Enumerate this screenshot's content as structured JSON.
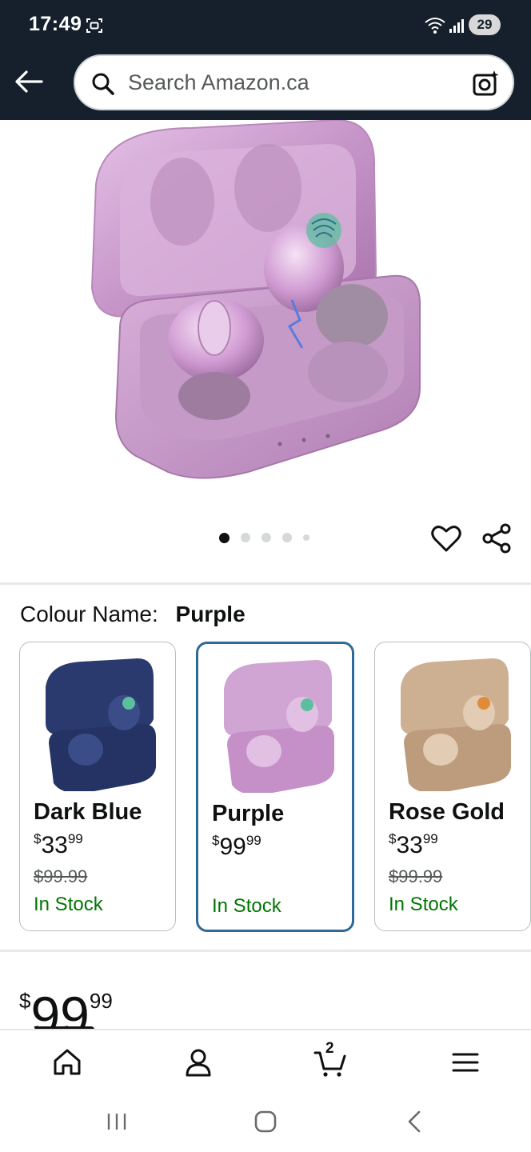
{
  "status_bar": {
    "time": "17:49",
    "battery": "29"
  },
  "search": {
    "placeholder": "Search Amazon.ca"
  },
  "gallery": {
    "image_count": 5,
    "active_index": 0
  },
  "colour": {
    "label": "Colour Name:",
    "selected": "Purple"
  },
  "swatches": [
    {
      "name": "Dark Blue",
      "currency": "$",
      "whole": "33",
      "cents": "99",
      "list_price": "$99.99",
      "stock": "In Stock",
      "color": "#2a3a6e"
    },
    {
      "name": "Purple",
      "currency": "$",
      "whole": "99",
      "cents": "99",
      "list_price": "",
      "stock": "In Stock",
      "color": "#c78fc2"
    },
    {
      "name": "Rose Gold",
      "currency": "$",
      "whole": "33",
      "cents": "99",
      "list_price": "$99.99",
      "stock": "In Stock",
      "color": "#c9a98a"
    }
  ],
  "price": {
    "currency": "$",
    "whole": "99",
    "cents": "99"
  },
  "bottom_nav": {
    "cart_count": "2"
  },
  "colors": {
    "header_bg": "#16202c",
    "in_stock": "#007600",
    "selected_border": "#2f6a96"
  }
}
